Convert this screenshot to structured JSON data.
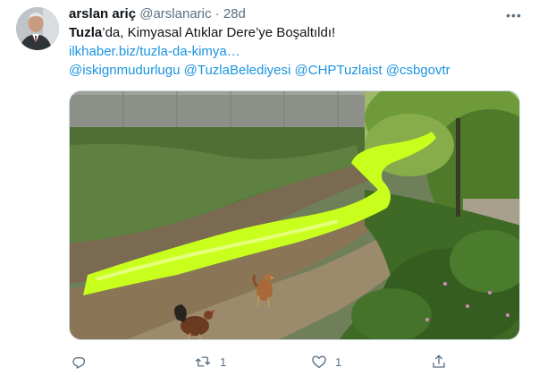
{
  "tweet": {
    "author_name": "arslan ariç",
    "author_handle": "@arslanaric",
    "separator": "·",
    "time": "28d",
    "text_bold": "Tuzla",
    "text_rest": "’da, Kimyasal Atıklar Dere’ye Boşaltıldı!",
    "link": "ilkhaber.biz/tuzla-da-kimya…",
    "mentions": [
      "@iskignmudurlugu",
      "@TuzlaBelediyesi",
      "@CHPTuzlaist",
      "@csbgovtr"
    ],
    "more_icon": "more-icon"
  },
  "actions": {
    "reply_icon": "reply-icon",
    "retweet_icon": "retweet-icon",
    "retweet_count": "1",
    "like_icon": "heart-icon",
    "like_count": "1",
    "share_icon": "share-icon"
  },
  "colors": {
    "link": "#1b95e0",
    "secondary_text": "#5b7083",
    "primary_text": "#0f1419",
    "stream": "#c8ff1c"
  }
}
